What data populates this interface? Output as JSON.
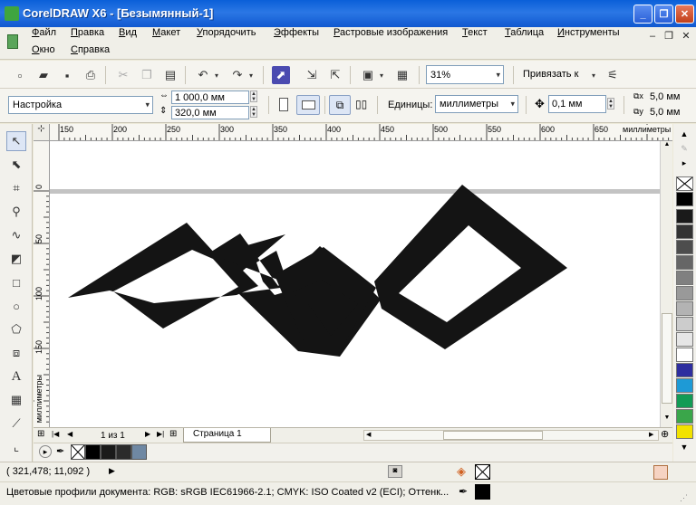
{
  "window": {
    "title": "CorelDRAW X6 - [Безымянный-1]"
  },
  "menu": {
    "items": [
      "Файл",
      "Правка",
      "Вид",
      "Макет",
      "Упорядочить",
      "Эффекты",
      "Растровые изображения",
      "Текст",
      "Таблица",
      "Инструменты"
    ],
    "row2": [
      "Окно",
      "Справка"
    ]
  },
  "std_toolbar": {
    "zoom": "31%",
    "snap_label": "Привязать к"
  },
  "prop_bar": {
    "preset": "Настройка",
    "page_width": "1 000,0 мм",
    "page_height": "320,0 мм",
    "units_label": "Единицы:",
    "units_value": "миллиметры",
    "nudge": "0,1 мм",
    "dup_x": "5,0 мм",
    "dup_y": "5,0 мм"
  },
  "hruler": {
    "labels": [
      "150",
      "200",
      "250",
      "300",
      "350",
      "400",
      "450",
      "500",
      "550",
      "600",
      "650"
    ],
    "unit": "миллиметры"
  },
  "vruler": {
    "labels": [
      "0",
      "50",
      "100",
      "150"
    ],
    "unit": "миллиметры"
  },
  "pagebar": {
    "counter": "1 из 1",
    "page_tab": "Страница 1"
  },
  "palette": {
    "colors": [
      "#000000",
      "#1a1a1a",
      "#333333",
      "#4d4d4d",
      "#666666",
      "#808080",
      "#999999",
      "#b3b3b3",
      "#cccccc",
      "#e6e6e6",
      "#ffffff",
      "#2e2e9f",
      "#1e9ad6",
      "#129b55",
      "#3aa64a",
      "#f2e200"
    ]
  },
  "doc_palette": {
    "colors": [
      "#000000",
      "#1a1a1a",
      "#2b2b2b",
      "#6f88a3"
    ]
  },
  "status": {
    "coords": "( 321,478; 11,092 )",
    "color_profiles": "Цветовые профили документа: RGB: sRGB IEC61966-2.1; CMYK: ISO Coated v2 (ECI); Оттенк..."
  }
}
